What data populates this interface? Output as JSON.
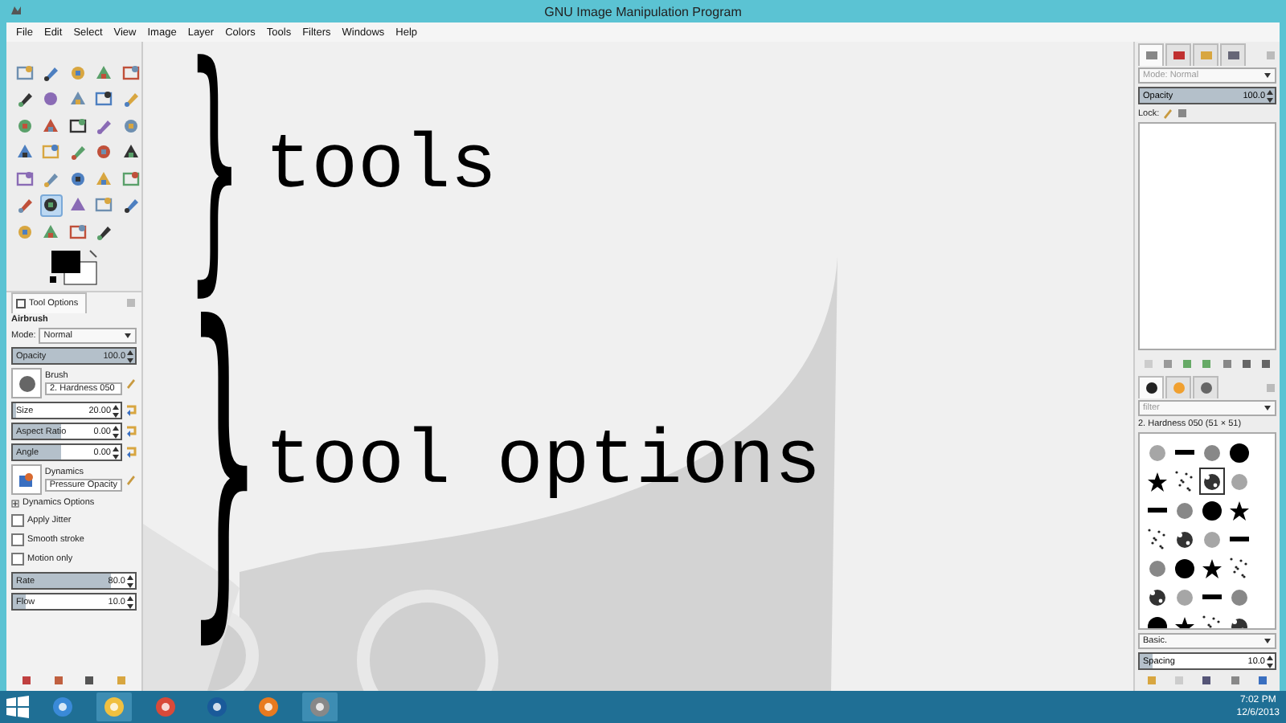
{
  "window": {
    "title": "GNU Image Manipulation Program"
  },
  "menu": [
    "File",
    "Edit",
    "Select",
    "View",
    "Image",
    "Layer",
    "Colors",
    "Tools",
    "Filters",
    "Windows",
    "Help"
  ],
  "toolbox": {
    "tools": [
      {
        "selected": false
      },
      {
        "selected": false
      },
      {
        "selected": false
      },
      {
        "selected": false
      },
      {
        "selected": false
      },
      {
        "selected": false
      },
      {
        "selected": false
      },
      {
        "selected": false
      },
      {
        "selected": false
      },
      {
        "selected": false
      },
      {
        "selected": false
      },
      {
        "selected": false
      },
      {
        "selected": false
      },
      {
        "selected": false
      },
      {
        "selected": false
      },
      {
        "selected": false
      },
      {
        "selected": false
      },
      {
        "selected": false
      },
      {
        "selected": false
      },
      {
        "selected": false
      },
      {
        "selected": false
      },
      {
        "selected": false
      },
      {
        "selected": false
      },
      {
        "selected": false
      },
      {
        "selected": false
      },
      {
        "selected": false
      },
      {
        "selected": true
      },
      {
        "selected": false
      },
      {
        "selected": false
      },
      {
        "selected": false
      },
      {
        "selected": false
      },
      {
        "selected": false
      },
      {
        "selected": false
      },
      {
        "selected": false
      }
    ]
  },
  "tool_options": {
    "tab": "Tool Options",
    "title": "Airbrush",
    "mode_label": "Mode:",
    "mode": "Normal",
    "opacity": {
      "label": "Opacity",
      "value": "100.0",
      "level": 1
    },
    "brush": {
      "label": "Brush",
      "value": "2. Hardness 050"
    },
    "size": {
      "label": "Size",
      "value": "20.00",
      "level": 0.03
    },
    "aspect_ratio": {
      "label": "Aspect Ratio",
      "value": "0.00",
      "level": 0.45
    },
    "angle": {
      "label": "Angle",
      "value": "0.00",
      "level": 0.45
    },
    "dynamics": {
      "label": "Dynamics",
      "value": "Pressure Opacity"
    },
    "dynamics_options": {
      "label": "Dynamics Options",
      "expanded": false
    },
    "options": [
      {
        "label": "Apply Jitter",
        "checked": false
      },
      {
        "label": "Smooth stroke",
        "checked": false
      },
      {
        "label": "Motion only",
        "checked": false
      }
    ],
    "rate": {
      "label": "Rate",
      "value": "80.0",
      "level": 0.8
    },
    "flow": {
      "label": "Flow",
      "value": "10.0",
      "level": 0.1
    }
  },
  "annotations": [
    {
      "brace": "}",
      "label": "tools"
    },
    {
      "brace": "}",
      "label": "tool options"
    }
  ],
  "layers": {
    "mode": "Mode: Normal",
    "opacity": {
      "label": "Opacity",
      "value": "100.0",
      "level": 1
    },
    "lock_label": "Lock:"
  },
  "brushes": {
    "filter_placeholder": "filter",
    "current": "2. Hardness 050 (51 × 51)",
    "items": [
      {
        "selected": false
      },
      {
        "selected": false
      },
      {
        "selected": false
      },
      {
        "selected": false
      },
      {
        "selected": false
      },
      {
        "selected": false
      },
      {
        "selected": true
      },
      {
        "selected": false
      },
      {
        "selected": false
      },
      {
        "selected": false
      },
      {
        "selected": false
      },
      {
        "selected": false
      },
      {
        "selected": false
      },
      {
        "selected": false
      },
      {
        "selected": false
      },
      {
        "selected": false
      },
      {
        "selected": false
      },
      {
        "selected": false
      },
      {
        "selected": false
      },
      {
        "selected": false
      },
      {
        "selected": false
      },
      {
        "selected": false
      },
      {
        "selected": false
      },
      {
        "selected": false
      },
      {
        "selected": false
      },
      {
        "selected": false
      },
      {
        "selected": false
      },
      {
        "selected": false
      }
    ],
    "tag": "Basic.",
    "spacing": {
      "label": "Spacing",
      "value": "10.0",
      "level": 0.1
    }
  },
  "taskbar": {
    "time": "7:02 PM",
    "date": "12/6/2013"
  }
}
